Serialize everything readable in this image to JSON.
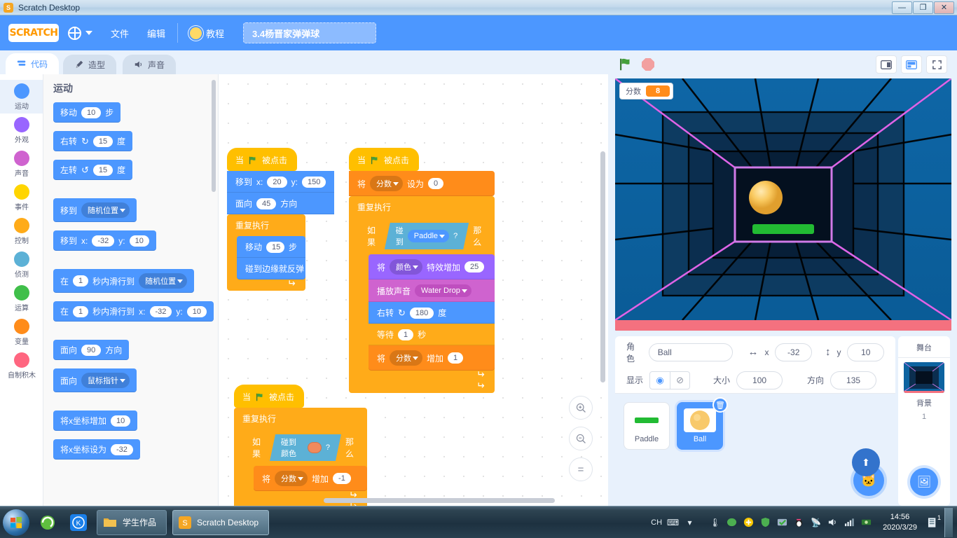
{
  "window": {
    "app_icon": "scratch-icon",
    "title": "Scratch Desktop",
    "minimize": "—",
    "maximize": "❐",
    "close": "✕"
  },
  "menubar": {
    "logo": "SCRATCH",
    "language_icon": "globe-icon",
    "items": [
      {
        "label": "文件",
        "name": "file"
      },
      {
        "label": "编辑",
        "name": "edit"
      }
    ],
    "tutorials": {
      "label": "教程",
      "icon": "lightbulb-icon"
    },
    "project_name": "3.4杨晋家弹弹球"
  },
  "tabs": [
    {
      "label": "代码",
      "icon": "code-icon",
      "active": true
    },
    {
      "label": "造型",
      "icon": "brush-icon",
      "active": false
    },
    {
      "label": "声音",
      "icon": "speaker-icon",
      "active": false
    }
  ],
  "categories": [
    {
      "label": "运动",
      "color": "#4c97ff",
      "selected": true
    },
    {
      "label": "外观",
      "color": "#9966ff",
      "selected": false
    },
    {
      "label": "声音",
      "color": "#cf63cf",
      "selected": false
    },
    {
      "label": "事件",
      "color": "#ffd500",
      "selected": false
    },
    {
      "label": "控制",
      "color": "#ffab19",
      "selected": false
    },
    {
      "label": "侦测",
      "color": "#5cb1d6",
      "selected": false
    },
    {
      "label": "运算",
      "color": "#40bf4a",
      "selected": false
    },
    {
      "label": "变量",
      "color": "#ff8c1a",
      "selected": false
    },
    {
      "label": "自制积木",
      "color": "#ff6680",
      "selected": false
    }
  ],
  "palette": {
    "heading": "运动",
    "blocks": {
      "move_label": "移动",
      "move_value": "10",
      "move_unit": "步",
      "turn_right_label": "右转",
      "turn_right_value": "15",
      "turn_right_unit": "度",
      "turn_left_label": "左转",
      "turn_left_value": "15",
      "turn_left_unit": "度",
      "goto_label": "移到",
      "goto_target": "随机位置",
      "gotoxy_label": "移到",
      "gotoxy_x_label": "x:",
      "gotoxy_x": "-32",
      "gotoxy_y_label": "y:",
      "gotoxy_y": "10",
      "glide_pre": "在",
      "glide_secs": "1",
      "glide_mid": "秒内滑行到",
      "glide_target": "随机位置",
      "glidexy_pre": "在",
      "glidexy_secs": "1",
      "glidexy_mid": "秒内滑行到",
      "glidexy_x_label": "x:",
      "glidexy_x": "-32",
      "glidexy_y_label": "y:",
      "glidexy_y": "10",
      "point_label": "面向",
      "point_value": "90",
      "point_unit": "方向",
      "point_towards_label": "面向",
      "point_towards_target": "鼠标指针",
      "changex_label": "将x坐标增加",
      "changex_value": "10",
      "setx_label": "将x坐标设为",
      "setx_value": "-32"
    }
  },
  "scripts": {
    "script1": {
      "hat": {
        "pre": "当",
        "icon": "green-flag-icon",
        "post": "被点击"
      },
      "gotoxy": {
        "label": "移到",
        "x_label": "x:",
        "x": "20",
        "y_label": "y:",
        "y": "150"
      },
      "point": {
        "label": "面向",
        "value": "45",
        "unit": "方向"
      },
      "forever": {
        "label": "重复执行"
      },
      "move": {
        "label": "移动",
        "value": "15",
        "unit": "步"
      },
      "bounce": {
        "label": "碰到边缘就反弹"
      }
    },
    "script2": {
      "hat": {
        "pre": "当",
        "icon": "green-flag-icon",
        "post": "被点击"
      },
      "setvar": {
        "pre": "将",
        "var": "分数",
        "mid": "设为",
        "value": "0"
      },
      "forever": {
        "label": "重复执行"
      },
      "if": {
        "pre": "如果",
        "post": "那么"
      },
      "touching": {
        "pre": "碰到",
        "target": "Paddle",
        "q": "?"
      },
      "changeeffect": {
        "pre": "将",
        "effect": "颜色",
        "mid": "特效增加",
        "value": "25"
      },
      "playsound": {
        "pre": "播放声音",
        "sound": "Water Drop"
      },
      "turnright": {
        "label": "右转",
        "value": "180",
        "unit": "度"
      },
      "wait": {
        "pre": "等待",
        "value": "1",
        "unit": "秒"
      },
      "changevar": {
        "pre": "将",
        "var": "分数",
        "mid": "增加",
        "value": "1"
      }
    },
    "script3": {
      "hat": {
        "pre": "当",
        "icon": "green-flag-icon",
        "post": "被点击"
      },
      "forever": {
        "label": "重复执行"
      },
      "if": {
        "pre": "如果",
        "post": "那么"
      },
      "touchingcolor": {
        "pre": "碰到颜色",
        "color": "#f08a5d",
        "q": "?"
      },
      "changevar": {
        "pre": "将",
        "var": "分数",
        "mid": "增加",
        "value": "-1"
      }
    }
  },
  "canvas_controls": {
    "zoom_in": "zoom-in-icon",
    "zoom_out": "zoom-out-icon",
    "zoom_reset": "="
  },
  "stage_header": {
    "green_flag": "green-flag-icon",
    "stop": "stop-icon",
    "small_stage": "small-stage-icon",
    "large_stage": "large-stage-icon",
    "fullscreen": "fullscreen-icon"
  },
  "stage": {
    "monitor": {
      "label": "分数",
      "value": "8"
    },
    "backdrop_name": "neon tunnel",
    "sprites_on_stage": [
      {
        "name": "Ball",
        "color": "#f8c96b"
      },
      {
        "name": "Paddle",
        "color": "#22bb33"
      }
    ]
  },
  "sprite_info": {
    "name_label": "角色",
    "name_value": "Ball",
    "x_label": "x",
    "x_value": "-32",
    "y_label": "y",
    "y_value": "10",
    "show_label": "显示",
    "show_icon": "eye-icon",
    "hide_icon": "eye-slash-icon",
    "size_label": "大小",
    "size_value": "100",
    "direction_label": "方向",
    "direction_value": "135"
  },
  "sprite_list": [
    {
      "name": "Paddle",
      "selected": false,
      "thumb": "green-paddle"
    },
    {
      "name": "Ball",
      "selected": true,
      "thumb": "orange-ball"
    }
  ],
  "sprite_buttons": {
    "add_sprite": "add-sprite-icon",
    "upload_sprite": "upload-sprite-icon"
  },
  "stage_panel": {
    "title": "舞台",
    "subtitle": "背景",
    "count": "1",
    "add_backdrop": "add-backdrop-icon"
  },
  "taskbar": {
    "start": "windows-start-orb",
    "quick_launch": [
      {
        "name": "browser-icon",
        "glyph": "e"
      },
      {
        "name": "kingsoft-icon",
        "glyph": "K"
      }
    ],
    "tasks": [
      {
        "label": "学生作品",
        "icon": "folder-icon",
        "active": false
      },
      {
        "label": "Scratch Desktop",
        "icon": "scratch-icon",
        "active": true
      }
    ],
    "tray": {
      "input_method": "CH",
      "keyboard_icon": "keyboard-icon",
      "expand_icon": "show-hidden-icons",
      "icons": [
        "thermometer-icon",
        "wechat-icon",
        "plus-circle-icon",
        "shield-icon",
        "checkmark-icon",
        "qq-penguin-icon",
        "satellite-icon",
        "volume-icon",
        "network-icon",
        "money-icon"
      ],
      "time": "14:56",
      "date": "2020/3/29",
      "notification_count": "1"
    }
  }
}
